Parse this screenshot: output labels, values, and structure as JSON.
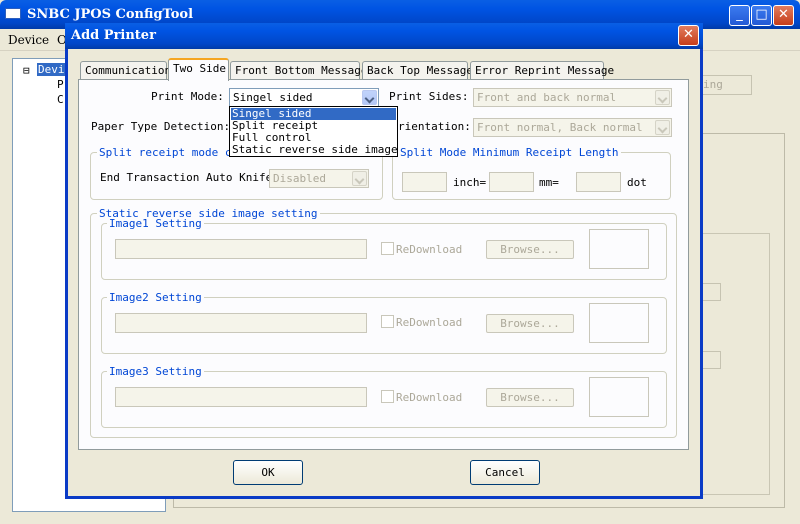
{
  "main_window": {
    "title": "SNBC JPOS ConfigTool",
    "menu": [
      "Device",
      "O"
    ],
    "tree_nodes": [
      "Devi",
      "P",
      "C"
    ],
    "bg_button_fragment": "ing",
    "caption_buttons": {
      "minimize": "_",
      "maximize": "□",
      "close": "✕"
    }
  },
  "dialog": {
    "title": "Add Printer",
    "close_glyph": "✕",
    "tabs": [
      "Communication",
      "Two Side",
      "Front Bottom Message",
      "Back Top Message",
      "Error Reprint Message"
    ],
    "active_tab": "Two Side",
    "print_mode": {
      "label": "Print Mode:",
      "value": "Singel sided",
      "options": [
        "Singel sided",
        "Split receipt",
        "Full control",
        "Static reverse side image"
      ]
    },
    "print_sides": {
      "label": "Print Sides:",
      "value": "Front and back normal"
    },
    "paper_type_detection": {
      "label": "Paper Type Detection:"
    },
    "orientation": {
      "label": "rientation:",
      "value": "Front normal, Back normal"
    },
    "split_cut_group": {
      "title": "Split receipt mode cu",
      "auto_knife_label": "End Transaction Auto Knife:",
      "auto_knife_value": "Disabled"
    },
    "min_length_group": {
      "title": "Split Mode Minimum Receipt Length",
      "inch_label": "inch=",
      "mm_label": "mm=",
      "dot_label": "dot"
    },
    "static_image_group": {
      "title": "Static reverse side image setting",
      "images": [
        {
          "title": "Image1 Setting",
          "redownload": "ReDownload",
          "browse": "Browse..."
        },
        {
          "title": "Image2 Setting",
          "redownload": "ReDownload",
          "browse": "Browse..."
        },
        {
          "title": "Image3 Setting",
          "redownload": "ReDownload",
          "browse": "Browse..."
        }
      ]
    },
    "ok_label": "OK",
    "cancel_label": "Cancel"
  }
}
